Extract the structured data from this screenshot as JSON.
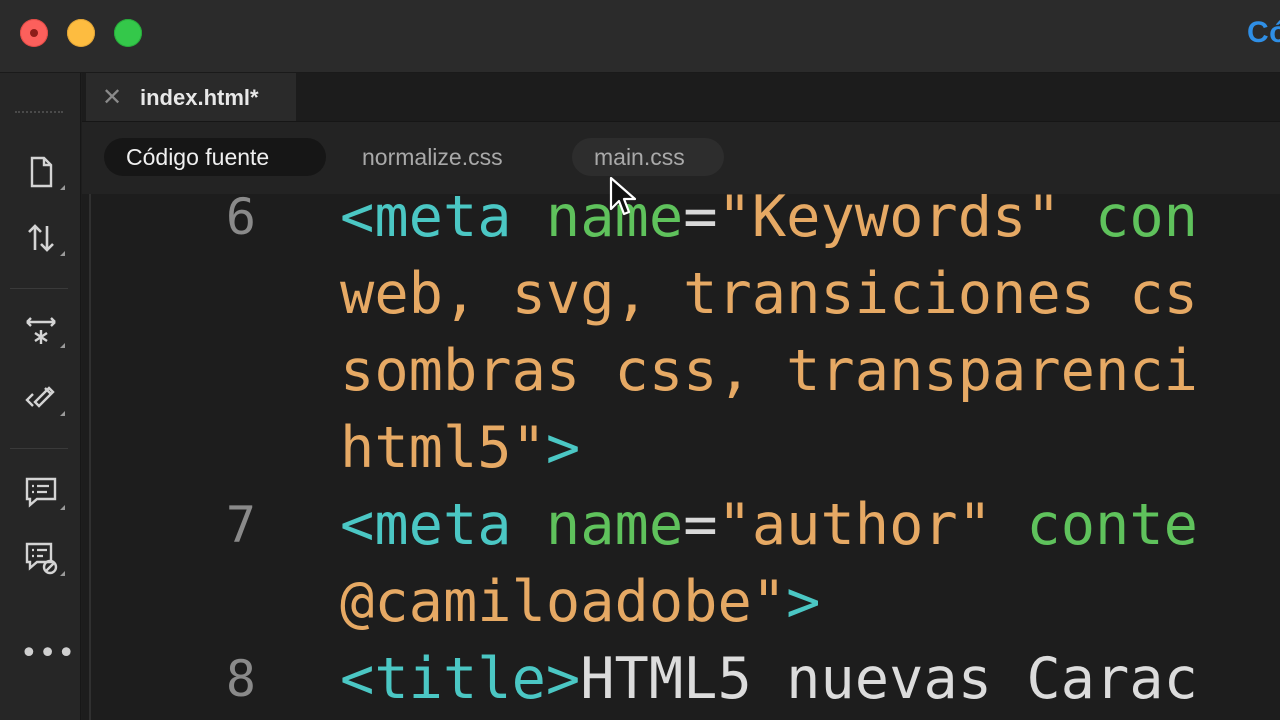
{
  "window": {
    "brand_partial": "Có"
  },
  "tabs": {
    "close_glyph": "✕",
    "document": "index.html*"
  },
  "related_files": [
    {
      "label": "Código fuente",
      "active": true
    },
    {
      "label": "normalize.css",
      "active": false
    },
    {
      "label": "main.css",
      "active": false
    }
  ],
  "toolbar": {
    "items": [
      "file-icon",
      "sync-arrows-icon",
      "expand-collapse-icon",
      "format-code-icon",
      "comment-icon",
      "remove-comment-icon"
    ],
    "more_label": "•••"
  },
  "editor": {
    "lines": [
      {
        "number": "6",
        "tokens": [
          {
            "t": "tag",
            "v": "<meta "
          },
          {
            "t": "attr",
            "v": "name"
          },
          {
            "t": "eq",
            "v": "="
          },
          {
            "t": "str",
            "v": "\"Keywords\" "
          },
          {
            "t": "attr",
            "v": "con"
          }
        ]
      },
      {
        "number": "",
        "tokens": [
          {
            "t": "str",
            "v": "web, svg, transiciones cs"
          }
        ]
      },
      {
        "number": "",
        "tokens": [
          {
            "t": "str",
            "v": "sombras css, transparenci"
          }
        ]
      },
      {
        "number": "",
        "tokens": [
          {
            "t": "str",
            "v": "html5\""
          },
          {
            "t": "tag",
            "v": ">"
          }
        ]
      },
      {
        "number": "7",
        "tokens": [
          {
            "t": "tag",
            "v": "<meta "
          },
          {
            "t": "attr",
            "v": "name"
          },
          {
            "t": "eq",
            "v": "="
          },
          {
            "t": "str",
            "v": "\"author\" "
          },
          {
            "t": "attr",
            "v": "conte"
          }
        ]
      },
      {
        "number": "",
        "tokens": [
          {
            "t": "str",
            "v": "@camiloadobe\""
          },
          {
            "t": "tag",
            "v": ">"
          }
        ]
      },
      {
        "number": "8",
        "tokens": [
          {
            "t": "tag",
            "v": "<title>"
          },
          {
            "t": "txt",
            "v": "HTML5 nuevas Carac"
          }
        ]
      }
    ]
  },
  "colors": {
    "tag": "#4bc7c4",
    "attribute": "#5fc25c",
    "string": "#e6a964",
    "text": "#dcdcdc",
    "brand": "#2f8fe6"
  }
}
